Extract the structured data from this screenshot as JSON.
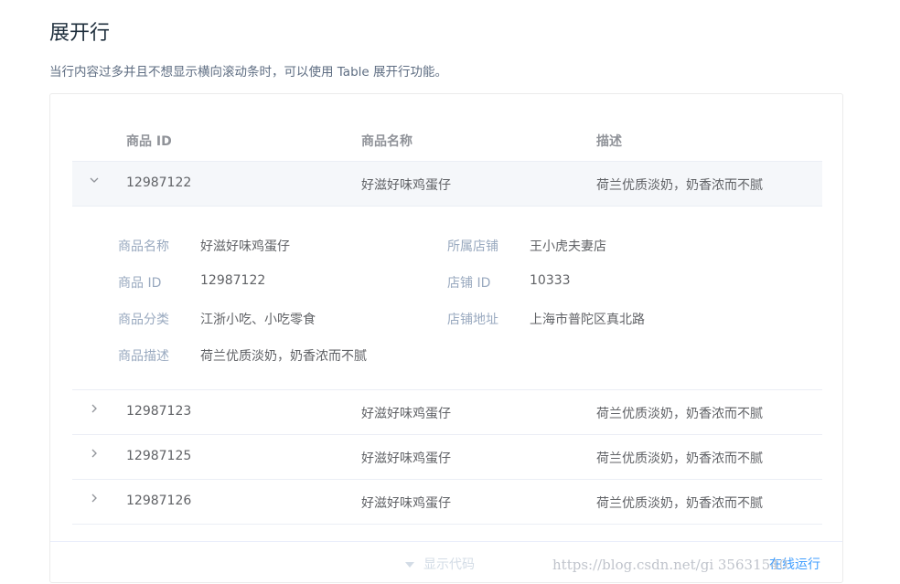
{
  "header": {
    "title": "展开行",
    "description": "当行内容过多并且不想显示横向滚动条时，可以使用 Table 展开行功能。"
  },
  "table": {
    "columns": [
      "商品 ID",
      "商品名称",
      "描述"
    ],
    "rows": [
      {
        "id": "12987122",
        "name": "好滋好味鸡蛋仔",
        "desc": "荷兰优质淡奶，奶香浓而不腻",
        "expanded": true
      },
      {
        "id": "12987123",
        "name": "好滋好味鸡蛋仔",
        "desc": "荷兰优质淡奶，奶香浓而不腻",
        "expanded": false
      },
      {
        "id": "12987125",
        "name": "好滋好味鸡蛋仔",
        "desc": "荷兰优质淡奶，奶香浓而不腻",
        "expanded": false
      },
      {
        "id": "12987126",
        "name": "好滋好味鸡蛋仔",
        "desc": "荷兰优质淡奶，奶香浓而不腻",
        "expanded": false
      }
    ],
    "expand_detail": {
      "left": [
        {
          "label": "商品名称",
          "value": "好滋好味鸡蛋仔"
        },
        {
          "label": "商品 ID",
          "value": "12987122"
        },
        {
          "label": "商品分类",
          "value": "江浙小吃、小吃零食"
        },
        {
          "label": "商品描述",
          "value": "荷兰优质淡奶，奶香浓而不腻"
        }
      ],
      "right": [
        {
          "label": "所属店铺",
          "value": "王小虎夫妻店"
        },
        {
          "label": "店铺 ID",
          "value": "10333"
        },
        {
          "label": "店铺地址",
          "value": "上海市普陀区真北路"
        }
      ]
    },
    "icons": {
      "expanded": "chevron-down-icon",
      "collapsed": "chevron-right-icon"
    }
  },
  "footer": {
    "show_code": "显示代码",
    "run_online": "在线运行"
  },
  "watermark": "https://blog.csdn.net/gi 35631540",
  "colors": {
    "accent": "#409eff",
    "label": "#99a9bf",
    "row_highlight": "#f5f7fa"
  }
}
